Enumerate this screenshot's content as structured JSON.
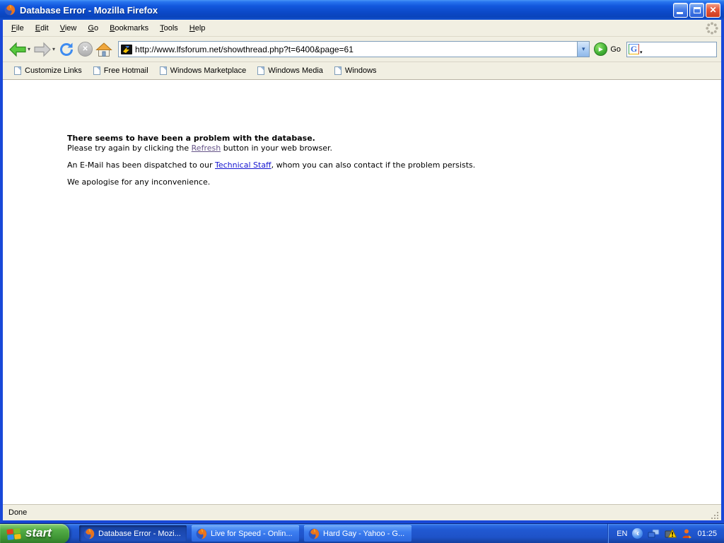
{
  "colors": {
    "titlebar_blue": "#0c49c8",
    "window_border_blue": "#1948d8",
    "toolbar_beige": "#f1efe2",
    "taskbar_blue": "#2159d2",
    "start_button_green": "#3f9635",
    "active_task_blue": "#1c4ab4",
    "link_blue": "#1515d0",
    "visited_link_purple": "#665588",
    "go_button_green": "#3fae33",
    "close_button_red": "#cc3a1c"
  },
  "window": {
    "title": "Database Error - Mozilla Firefox"
  },
  "icons": {
    "close": "✕",
    "dropdown_caret": "▾",
    "go_arrow": "▶",
    "stop_x": "✕",
    "tray_chevron": "‹",
    "google_g": "G",
    "search_caret": "▾"
  },
  "menubar": {
    "items": [
      {
        "label": "File"
      },
      {
        "label": "Edit"
      },
      {
        "label": "View"
      },
      {
        "label": "Go"
      },
      {
        "label": "Bookmarks"
      },
      {
        "label": "Tools"
      },
      {
        "label": "Help"
      }
    ]
  },
  "navbar": {
    "url": "http://www.lfsforum.net/showthread.php?t=6400&page=61",
    "go_label": "Go"
  },
  "bookmarks_bar": {
    "items": [
      {
        "label": "Customize Links"
      },
      {
        "label": "Free Hotmail"
      },
      {
        "label": "Windows Marketplace"
      },
      {
        "label": "Windows Media"
      },
      {
        "label": "Windows"
      }
    ]
  },
  "page": {
    "heading": "There seems to have been a problem with the database.",
    "refresh_line": {
      "pre": "Please try again by clicking the ",
      "link": "Refresh",
      "post": " button in your web browser."
    },
    "email_line": {
      "pre": "An E-Mail has been dispatched to our ",
      "link": "Technical Staff",
      "post": ", whom you can also contact if the problem persists."
    },
    "apology": "We apologise for any inconvenience."
  },
  "statusbar": {
    "text": "Done"
  },
  "taskbar": {
    "start_label": "start",
    "tasks": [
      {
        "label": "Database Error - Mozi...",
        "active": true
      },
      {
        "label": "Live for Speed - Onlin...",
        "active": false
      },
      {
        "label": "Hard Gay - Yahoo - G...",
        "active": false
      }
    ],
    "tray": {
      "language": "EN",
      "clock": "01:25"
    }
  }
}
